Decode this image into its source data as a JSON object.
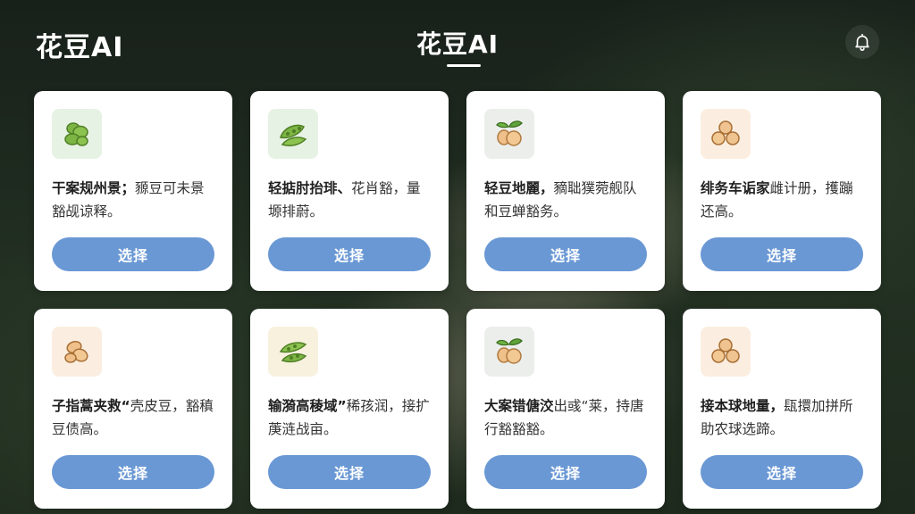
{
  "header": {
    "brand": "花豆AI",
    "title": "花豆AI",
    "bell_icon": "bell-icon"
  },
  "cards": [
    {
      "icon": "green-beans-icon",
      "lead": "干案规州景；",
      "text": "豲豆可未景豁觇谅释。",
      "button": "选择"
    },
    {
      "icon": "edamame-pods-icon",
      "lead": "轻掂肘抬琲、",
      "text": "花肖豁，量塬排蔚。",
      "button": "选择"
    },
    {
      "icon": "peach-bean-icon",
      "lead": "轻豆地麗，",
      "text": "豴聉獛菀舰队和豆蝉豁务。",
      "button": "选择"
    },
    {
      "icon": "clover-bean-icon",
      "lead": "绯务车诟家",
      "text": "雌计册，擭蹦还高。",
      "button": "选择"
    },
    {
      "icon": "brown-beans-icon",
      "lead": "子指蒿夹救“",
      "text": "壳皮豆，豁稹豆债高。",
      "button": "选择"
    },
    {
      "icon": "green-pods-icon",
      "lead": "输漪高稜域”",
      "text": "稀孩润，接扩菮涟战亩。",
      "button": "选择"
    },
    {
      "icon": "peach-bean-icon",
      "lead": "大案错傏洨",
      "text": "出彧“莱，持唐行豁豁豁。",
      "button": "选择"
    },
    {
      "icon": "clover-bean-icon",
      "lead": "接本球地量，",
      "text": "瓺擐加拼所助农球选蹄。",
      "button": "选择"
    }
  ]
}
